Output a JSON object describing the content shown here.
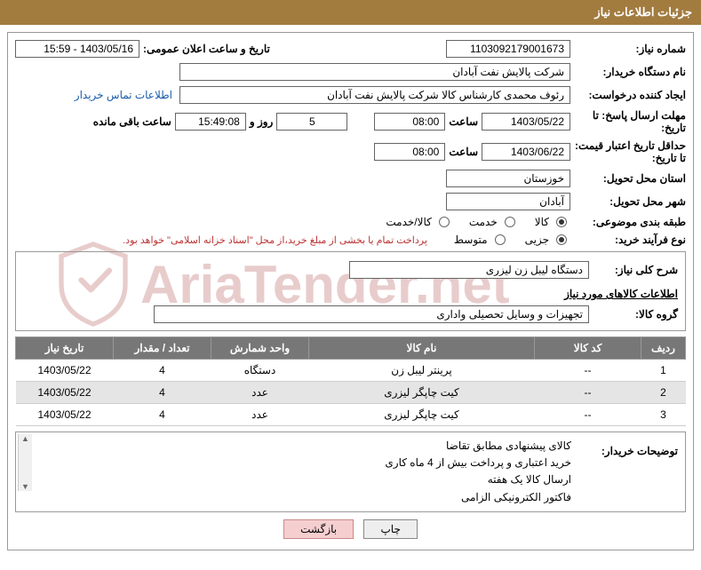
{
  "header": {
    "title": "جزئیات اطلاعات نیاز"
  },
  "fields": {
    "req_no_label": "شماره نیاز:",
    "req_no": "1103092179001673",
    "announce_label": "تاریخ و ساعت اعلان عمومی:",
    "announce": "1403/05/16 - 15:59",
    "buyer_org_label": "نام دستگاه خریدار:",
    "buyer_org": "شرکت پالایش نفت آبادان",
    "requester_label": "ایجاد کننده درخواست:",
    "requester": "رئوف محمدی کارشناس کالا شرکت پالایش نفت آبادان",
    "contact_link": "اطلاعات تماس خریدار",
    "reply_deadline_label": "مهلت ارسال پاسخ: تا تاریخ:",
    "reply_date": "1403/05/22",
    "time_label": "ساعت",
    "reply_time": "08:00",
    "days": "5",
    "days_and": "روز و",
    "remaining_time": "15:49:08",
    "remaining_label": "ساعت باقی مانده",
    "validity_label": "حداقل تاریخ اعتبار قیمت: تا تاریخ:",
    "validity_date": "1403/06/22",
    "validity_time": "08:00",
    "province_label": "استان محل تحویل:",
    "province": "خوزستان",
    "city_label": "شهر محل تحویل:",
    "city": "آبادان",
    "class_label": "طبقه بندی موضوعی:",
    "class_opts": [
      "کالا",
      "خدمت",
      "کالا/خدمت"
    ],
    "process_label": "نوع فرآیند خرید:",
    "process_opts": [
      "جزیی",
      "متوسط"
    ],
    "process_note": "پرداخت تمام یا بخشی از مبلغ خرید،از محل \"اسناد خزانه اسلامی\" خواهد بود.",
    "summary_label": "شرح کلی نیاز:",
    "summary": "دستگاه لیبل زن لیزری",
    "items_section": "اطلاعات کالاهای مورد نیاز",
    "group_label": "گروه کالا:",
    "group": "تجهیزات و وسایل تحصیلی واداری",
    "buyer_notes_label": "توضیحات خریدار:",
    "buyer_notes": [
      "کالای پیشنهادی مطابق تقاضا",
      "خرید اعتباری  و پرداخت بیش از 4 ماه کاری",
      "ارسال کالا یک هفته",
      "فاکتور الکترونیکی الزامی"
    ]
  },
  "table": {
    "headers": [
      "ردیف",
      "کد کالا",
      "نام کالا",
      "واحد شمارش",
      "تعداد / مقدار",
      "تاریخ نیاز"
    ],
    "rows": [
      {
        "n": "1",
        "code": "--",
        "name": "پرینتر لیبل زن",
        "unit": "دستگاه",
        "qty": "4",
        "date": "1403/05/22"
      },
      {
        "n": "2",
        "code": "--",
        "name": "کیت چاپگر لیزری",
        "unit": "عدد",
        "qty": "4",
        "date": "1403/05/22"
      },
      {
        "n": "3",
        "code": "--",
        "name": "کیت چاپگر لیزری",
        "unit": "عدد",
        "qty": "4",
        "date": "1403/05/22"
      }
    ]
  },
  "buttons": {
    "print": "چاپ",
    "back": "بازگشت"
  },
  "watermark": {
    "text": "AriaTender.net"
  }
}
